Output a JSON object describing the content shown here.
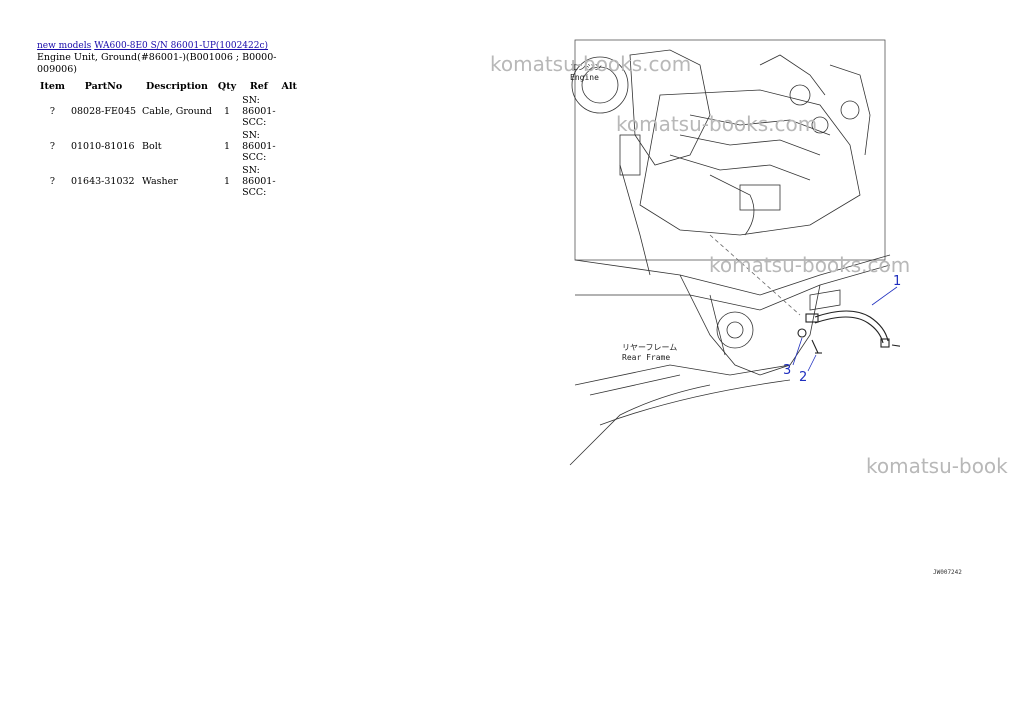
{
  "breadcrumb": {
    "link1": "new models",
    "link2": "WA600-8E0 S/N 86001-UP(1002422c)"
  },
  "subtitle": "Engine Unit, Ground(#86001-)(B001006 ; B0000-009006)",
  "table": {
    "headers": [
      "Item",
      "PartNo",
      "Description",
      "Qty",
      "Ref",
      "Alt"
    ],
    "rows": [
      {
        "item": "?",
        "partno": "08028-FE045",
        "description": "Cable, Ground",
        "qty": "1",
        "ref": "SN: 86001-SCC:",
        "alt": ""
      },
      {
        "item": "?",
        "partno": "01010-81016",
        "description": "Bolt",
        "qty": "1",
        "ref": "SN: 86001-SCC:",
        "alt": ""
      },
      {
        "item": "?",
        "partno": "01643-31032",
        "description": "Washer",
        "qty": "1",
        "ref": "SN: 86001-SCC:",
        "alt": ""
      }
    ]
  },
  "drawing": {
    "watermark": "komatsu-books.com",
    "watermark_short": "komatsu-book",
    "engine_label_jp": "エンジン",
    "engine_label": "Engine",
    "rear_frame_label_jp": "リヤーフレーム",
    "rear_frame_label": "Rear Frame",
    "callouts": [
      "1",
      "2",
      "3"
    ],
    "drawing_code": "JW007242",
    "callout_color": "#1f2fbf",
    "watermark_color": "#b8b8b8"
  }
}
